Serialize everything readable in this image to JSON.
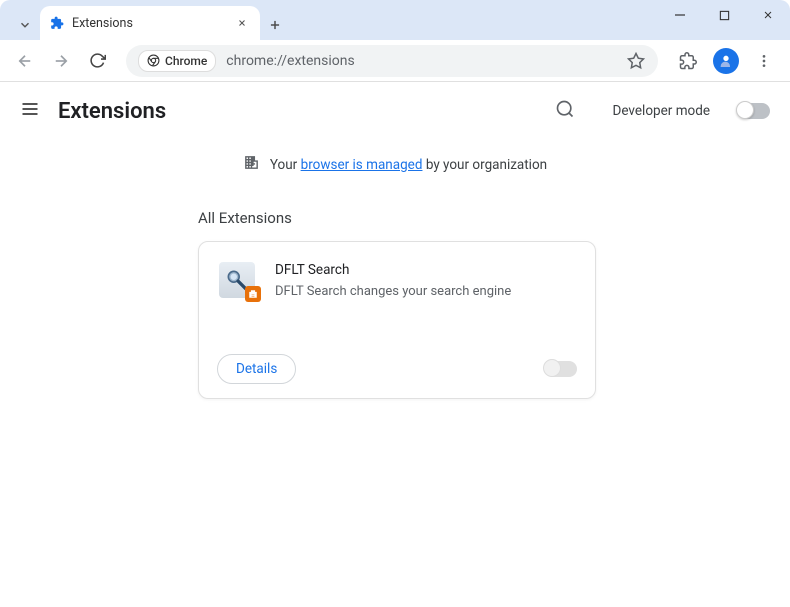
{
  "tab": {
    "title": "Extensions"
  },
  "omnibox": {
    "site_label": "Chrome",
    "url": "chrome://extensions"
  },
  "page": {
    "title": "Extensions"
  },
  "dev_mode": {
    "label": "Developer mode"
  },
  "banner": {
    "prefix": "Your ",
    "link": "browser is managed",
    "suffix": " by your organization"
  },
  "section": {
    "all_extensions": "All Extensions"
  },
  "extension": {
    "name": "DFLT Search",
    "description": "DFLT Search changes your search engine",
    "details_button": "Details"
  }
}
